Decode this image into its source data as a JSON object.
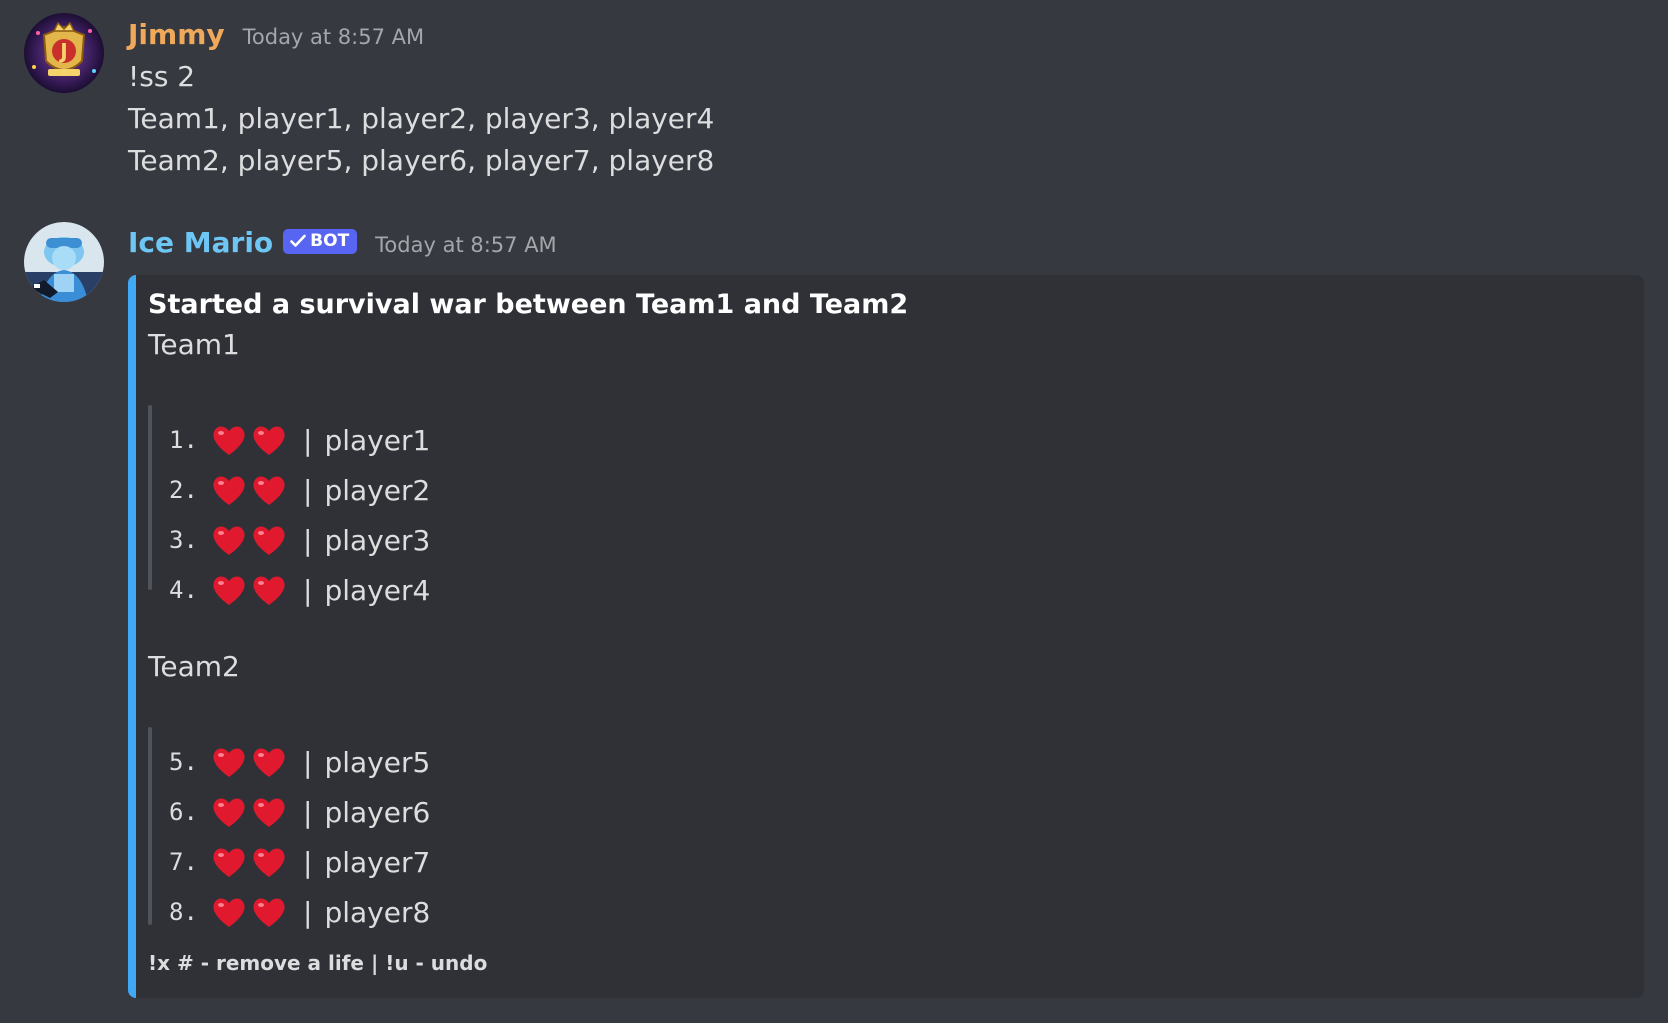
{
  "colors": {
    "background": "#36393f",
    "embed_background": "#2f3136",
    "embed_accent": "#3fa9f5",
    "jimmy_name": "#f0a95a",
    "bot_name": "#6ec6f5",
    "bot_badge": "#5865f2",
    "heart": "#e0192f"
  },
  "messages": [
    {
      "author": "Jimmy",
      "timestamp": "Today at 8:57 AM",
      "avatar_icon": "jimmy-crest-avatar",
      "lines": [
        "!ss 2",
        "Team1, player1, player2, player3, player4",
        "Team2, player5, player6, player7, player8"
      ]
    },
    {
      "author": "Ice Mario",
      "badge": "BOT",
      "timestamp": "Today at 8:57 AM",
      "avatar_icon": "ice-mario-avatar",
      "embed": {
        "title": "Started a survival war between Team1 and Team2",
        "teams": [
          {
            "name": "Team1",
            "players": [
              {
                "num": "1.",
                "hearts": 2,
                "name": "player1"
              },
              {
                "num": "2.",
                "hearts": 2,
                "name": "player2"
              },
              {
                "num": "3.",
                "hearts": 2,
                "name": "player3"
              },
              {
                "num": "4.",
                "hearts": 2,
                "name": "player4"
              }
            ]
          },
          {
            "name": "Team2",
            "players": [
              {
                "num": "5.",
                "hearts": 2,
                "name": "player5"
              },
              {
                "num": "6.",
                "hearts": 2,
                "name": "player6"
              },
              {
                "num": "7.",
                "hearts": 2,
                "name": "player7"
              },
              {
                "num": "8.",
                "hearts": 2,
                "name": "player8"
              }
            ]
          }
        ],
        "separator": "|",
        "footer": "!x # - remove a life | !u - undo"
      }
    }
  ]
}
